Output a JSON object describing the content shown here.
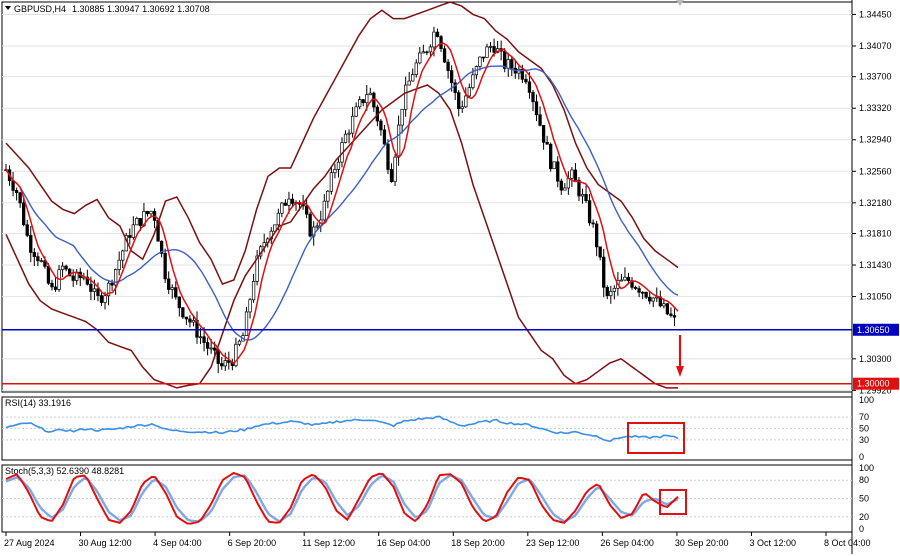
{
  "header": {
    "symbol_label": "GBPUSD,H4",
    "ohlc_label": "1.30885 1.30947 1.30692 1.30708",
    "rsi_label": "RSI(14) 33.1916",
    "stoch_label": "Stoch(5,3,3) 52.6390 48.8281"
  },
  "colors": {
    "bull_body": "#ffffff",
    "bear_body": "#000000",
    "bollinger": "#7a1010",
    "ma_fast": "#e01010",
    "ma_slow": "#3a5fc8",
    "support_line": "#0000c0",
    "target_line": "#e01010",
    "rsi_line": "#3a8ee6",
    "stoch_main": "#e01010",
    "stoch_signal": "#7ea7e6",
    "highlight_box": "#e01010",
    "arrow": "#e01010",
    "grid": "#e3e3e3"
  },
  "chart_data": [
    {
      "type": "candlestick",
      "title": "GBPUSD,H4",
      "y_ticks": [
        "1.34450",
        "1.34070",
        "1.33700",
        "1.33320",
        "1.32940",
        "1.32560",
        "1.32180",
        "1.31810",
        "1.31430",
        "1.31050",
        "1.30300",
        "1.29920"
      ],
      "ylim": [
        1.299,
        1.346
      ],
      "x_ticks": [
        "27 Aug 2024",
        "30 Aug 12:00",
        "4 Sep 04:00",
        "6 Sep 20:00",
        "11 Sep 12:00",
        "16 Sep 04:00",
        "18 Sep 20:00",
        "23 Sep 12:00",
        "26 Sep 04:00",
        "30 Sep 20:00",
        "3 Oct 12:00",
        "8 Oct 04:00"
      ],
      "price_path": [
        1.3258,
        1.323,
        1.317,
        1.315,
        1.311,
        1.314,
        1.3125,
        1.313,
        1.31,
        1.3115,
        1.315,
        1.3185,
        1.32,
        1.321,
        1.3135,
        1.31,
        1.308,
        1.306,
        1.304,
        1.302,
        1.303,
        1.306,
        1.314,
        1.318,
        1.32,
        1.323,
        1.3215,
        1.318,
        1.321,
        1.326,
        1.33,
        1.333,
        1.3355,
        1.331,
        1.325,
        1.334,
        1.338,
        1.34,
        1.343,
        1.338,
        1.333,
        1.336,
        1.3395,
        1.341,
        1.3385,
        1.338,
        1.337,
        1.332,
        1.327,
        1.324,
        1.325,
        1.322,
        1.318,
        1.31,
        1.312,
        1.3125,
        1.3115,
        1.3105,
        1.309,
        1.3075
      ],
      "bollinger_upper": [
        1.329,
        1.3275,
        1.326,
        1.324,
        1.322,
        1.321,
        1.3205,
        1.3215,
        1.3222,
        1.32,
        1.319,
        1.316,
        1.315,
        1.318,
        1.322,
        1.3225,
        1.32,
        1.317,
        1.315,
        1.312,
        1.3125,
        1.316,
        1.321,
        1.325,
        1.326,
        1.326,
        1.329,
        1.332,
        1.3345,
        1.337,
        1.3395,
        1.342,
        1.344,
        1.345,
        1.344,
        1.344,
        1.3445,
        1.345,
        1.3455,
        1.346,
        1.3455,
        1.3445,
        1.344,
        1.3425,
        1.3415,
        1.34,
        1.339,
        1.338,
        1.336,
        1.333,
        1.329,
        1.326,
        1.324,
        1.323,
        1.322,
        1.32,
        1.3175,
        1.316,
        1.315,
        1.314
      ],
      "bollinger_lower": [
        1.318,
        1.315,
        1.312,
        1.31,
        1.309,
        1.3085,
        1.308,
        1.3075,
        1.3065,
        1.305,
        1.3045,
        1.304,
        1.302,
        1.3005,
        1.3,
        1.2995,
        1.2998,
        1.3,
        1.302,
        1.306,
        1.31,
        1.313,
        1.315,
        1.317,
        1.319,
        1.3195,
        1.3215,
        1.3235,
        1.325,
        1.327,
        1.3285,
        1.33,
        1.3315,
        1.333,
        1.334,
        1.335,
        1.3355,
        1.336,
        1.335,
        1.333,
        1.329,
        1.324,
        1.32,
        1.316,
        1.312,
        1.308,
        1.306,
        1.304,
        1.303,
        1.301,
        1.3,
        1.3005,
        1.3015,
        1.3025,
        1.303,
        1.302,
        1.301,
        1.3,
        1.2995,
        1.2995
      ],
      "support_level": 1.3065,
      "support_label": "1.30650",
      "target_level": 1.3,
      "target_label": "1.30000",
      "last_price_label": "1.30708"
    },
    {
      "type": "line",
      "title": "RSI(14) 33.1916",
      "y_ticks": [
        "100",
        "70",
        "50",
        "30",
        "0"
      ],
      "ylim": [
        0,
        100
      ],
      "values": [
        52,
        56,
        60,
        50,
        44,
        48,
        45,
        50,
        47,
        48,
        50,
        54,
        56,
        58,
        48,
        46,
        45,
        44,
        44,
        42,
        46,
        48,
        55,
        58,
        60,
        62,
        60,
        56,
        58,
        62,
        64,
        65,
        66,
        60,
        55,
        63,
        66,
        68,
        70,
        62,
        55,
        58,
        62,
        64,
        60,
        58,
        56,
        50,
        44,
        42,
        44,
        40,
        36,
        28,
        35,
        36,
        34,
        35,
        37,
        33
      ]
    },
    {
      "type": "line",
      "title": "Stoch(5,3,3) 52.6390 48.8281",
      "y_ticks": [
        "100",
        "80",
        "50",
        "20",
        "0"
      ],
      "ylim": [
        0,
        100
      ],
      "series": [
        {
          "values": [
            82,
            90,
            60,
            20,
            12,
            40,
            85,
            88,
            50,
            15,
            10,
            30,
            75,
            88,
            60,
            20,
            8,
            12,
            40,
            80,
            92,
            85,
            45,
            12,
            10,
            35,
            80,
            90,
            70,
            30,
            15,
            50,
            85,
            92,
            70,
            25,
            12,
            40,
            88,
            90,
            75,
            35,
            12,
            20,
            60,
            85,
            80,
            40,
            15,
            10,
            30,
            62,
            75,
            40,
            18,
            25,
            60,
            45,
            35,
            53
          ]
        },
        {
          "values": [
            78,
            85,
            68,
            35,
            18,
            32,
            70,
            85,
            62,
            28,
            14,
            22,
            60,
            82,
            70,
            35,
            14,
            12,
            28,
            65,
            85,
            88,
            60,
            25,
            12,
            25,
            65,
            85,
            78,
            45,
            22,
            38,
            72,
            88,
            78,
            40,
            18,
            30,
            75,
            88,
            80,
            50,
            22,
            18,
            45,
            75,
            82,
            55,
            25,
            12,
            22,
            50,
            70,
            50,
            28,
            22,
            45,
            50,
            40,
            49
          ]
        }
      ]
    }
  ],
  "annotations": {
    "down_arrow": "bearish-target-arrow",
    "rsi_box": "rsi-highlight-box",
    "stoch_box": "stoch-highlight-box"
  }
}
